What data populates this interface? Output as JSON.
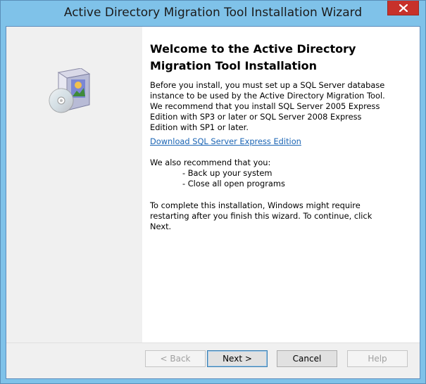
{
  "window": {
    "title": "Active Directory Migration Tool Installation Wizard"
  },
  "welcome": {
    "heading": "Welcome to the Active Directory Migration Tool Installation",
    "intro_lines": [
      "Before you install, you must set up a SQL Server database",
      "instance to be used by the Active Directory Migration Tool.",
      "We recommend that you install SQL Server 2005 Express",
      "Edition with SP3 or later or SQL Server 2008 Express",
      "Edition with SP1 or later."
    ],
    "download_link": "Download SQL Server Express Edition",
    "recommend_intro": "We also recommend that you:",
    "recommend_items": [
      "- Back up your system",
      "- Close all open programs"
    ],
    "closing_lines": [
      "To complete this installation, Windows might require",
      "restarting after you finish this wizard. To continue, click",
      "Next."
    ]
  },
  "buttons": {
    "back": "< Back",
    "next": "Next >",
    "cancel": "Cancel",
    "help": "Help"
  },
  "icons": {
    "close": "close-icon",
    "setup": "software-box-cd-icon"
  },
  "colors": {
    "titlebar": "#7fc2e9",
    "close_button": "#c7312a",
    "link": "#1a64b4",
    "side_panel": "#f0f0f0"
  }
}
